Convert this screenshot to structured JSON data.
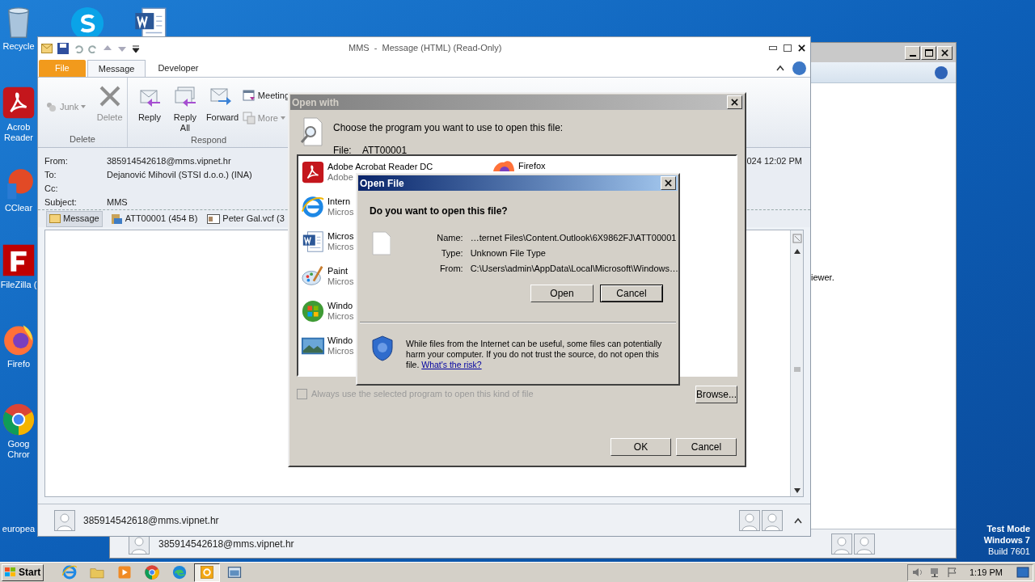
{
  "desktop": {
    "icons": [
      {
        "kind": "recycle-bin",
        "lines": [
          "Recycle"
        ]
      },
      {
        "kind": "pdf",
        "lines": [
          "Acrob",
          "Reader"
        ]
      },
      {
        "kind": "cleaner",
        "lines": [
          "CClear"
        ]
      },
      {
        "kind": "ftp",
        "lines": [
          "FileZilla ("
        ]
      },
      {
        "kind": "fox",
        "lines": [
          "Firefo"
        ]
      },
      {
        "kind": "chrome",
        "lines": [
          "Goog",
          "Chror"
        ]
      },
      {
        "kind": "blank",
        "lines": [
          "europea"
        ]
      }
    ],
    "top_icons": [
      {
        "kind": "chat"
      },
      {
        "kind": "word"
      }
    ],
    "os_notice": [
      "Test Mode",
      "Windows 7",
      "Build 7601"
    ]
  },
  "back_window": {
    "body_text": "iewer.",
    "sender": "385914542618@mms.vipnet.hr"
  },
  "message_window": {
    "title": "MMS  -  Message (HTML) (Read-Only)",
    "tabs": [
      {
        "label": "File",
        "kind": "file",
        "selected": false
      },
      {
        "label": "Message",
        "kind": "tab",
        "selected": true
      },
      {
        "label": "Developer",
        "kind": "tab",
        "selected": false
      }
    ],
    "ribbon_groups": [
      {
        "label": "Delete",
        "commands": [
          {
            "label": "Junk",
            "kind": "small",
            "disabled": true
          },
          {
            "label": "Delete",
            "kind": "large",
            "disabled": true
          }
        ]
      },
      {
        "label": "Respond",
        "commands": [
          {
            "label": "Reply",
            "kind": "large",
            "disabled": false
          },
          {
            "label": "Reply All",
            "kind": "large",
            "disabled": false
          },
          {
            "label": "Forward",
            "kind": "large",
            "disabled": false
          },
          {
            "label": "Meeting",
            "kind": "small",
            "disabled": false
          },
          {
            "label": "More",
            "kind": "small",
            "disabled": true
          }
        ]
      }
    ],
    "header_fields": [
      {
        "label": "From:",
        "value": "385914542618@mms.vipnet.hr"
      },
      {
        "label": "To:",
        "value": "Dejanović Mihovil (STSI d.o.o.) (INA)"
      },
      {
        "label": "Cc:"
      },
      {
        "label": "Subject:",
        "value": "MMS"
      }
    ],
    "sent_fragment": "024 12:02 PM",
    "attachments": [
      {
        "label": "Message",
        "kind": "message",
        "selected": true
      },
      {
        "label": "ATT00001 (454 B)",
        "kind": "file",
        "selected": false
      },
      {
        "label": "Peter Gal.vcf (3",
        "kind": "card",
        "selected": false
      }
    ],
    "footer": {
      "sender": "385914542618@mms.vipnet.hr"
    }
  },
  "open_with": {
    "title": "Open with",
    "prompt": "Choose the program you want to use to open this file:",
    "file_label": "File:",
    "file_name": "ATT00001",
    "programs": [
      {
        "name": "Adobe Acrobat Reader DC",
        "publisher": "Adobe",
        "kind": "pdf"
      },
      {
        "name": "Intern",
        "publisher": "Micros",
        "kind": "browser"
      },
      {
        "name": "Micros",
        "publisher": "Micros",
        "kind": "word"
      },
      {
        "name": "Paint",
        "publisher": "Micros",
        "kind": "paint"
      },
      {
        "name": "Windo",
        "publisher": "Micros",
        "kind": "media"
      },
      {
        "name": "Windo",
        "publisher": "Micros",
        "kind": "photo"
      }
    ],
    "programs_col2": [
      {
        "name": "Firefox",
        "kind": "fox"
      }
    ],
    "always_use": {
      "label": "Always use the selected program to open this kind of file",
      "checked": false,
      "disabled": true
    },
    "browse": "Browse...",
    "buttons": [
      "OK",
      "Cancel"
    ]
  },
  "open_file": {
    "title": "Open File",
    "question": "Do you want to open this file?",
    "details": [
      {
        "label": "Name:",
        "value": "…ternet Files\\Content.Outlook\\6X9862FJ\\ATT00001"
      },
      {
        "label": "Type:",
        "value": "Unknown File Type"
      },
      {
        "label": "From:",
        "value": "C:\\Users\\admin\\AppData\\Local\\Microsoft\\Windows…"
      }
    ],
    "buttons": [
      {
        "label": "Open",
        "focused": false
      },
      {
        "label": "Cancel",
        "focused": true
      }
    ],
    "warning": "While files from the Internet can be useful, some files can potentially harm your computer. If you do not trust the source, do not open this file.",
    "risk_link": "What's the risk?"
  },
  "taskbar": {
    "start": "Start",
    "apps": [
      {
        "kind": "browser",
        "selected": false
      },
      {
        "kind": "folder",
        "selected": false
      },
      {
        "kind": "player",
        "selected": false
      },
      {
        "kind": "chrome",
        "selected": false
      },
      {
        "kind": "edge",
        "selected": false
      },
      {
        "kind": "mail",
        "selected": true
      },
      {
        "kind": "window",
        "selected": false
      }
    ],
    "clock": "1:19 PM"
  }
}
